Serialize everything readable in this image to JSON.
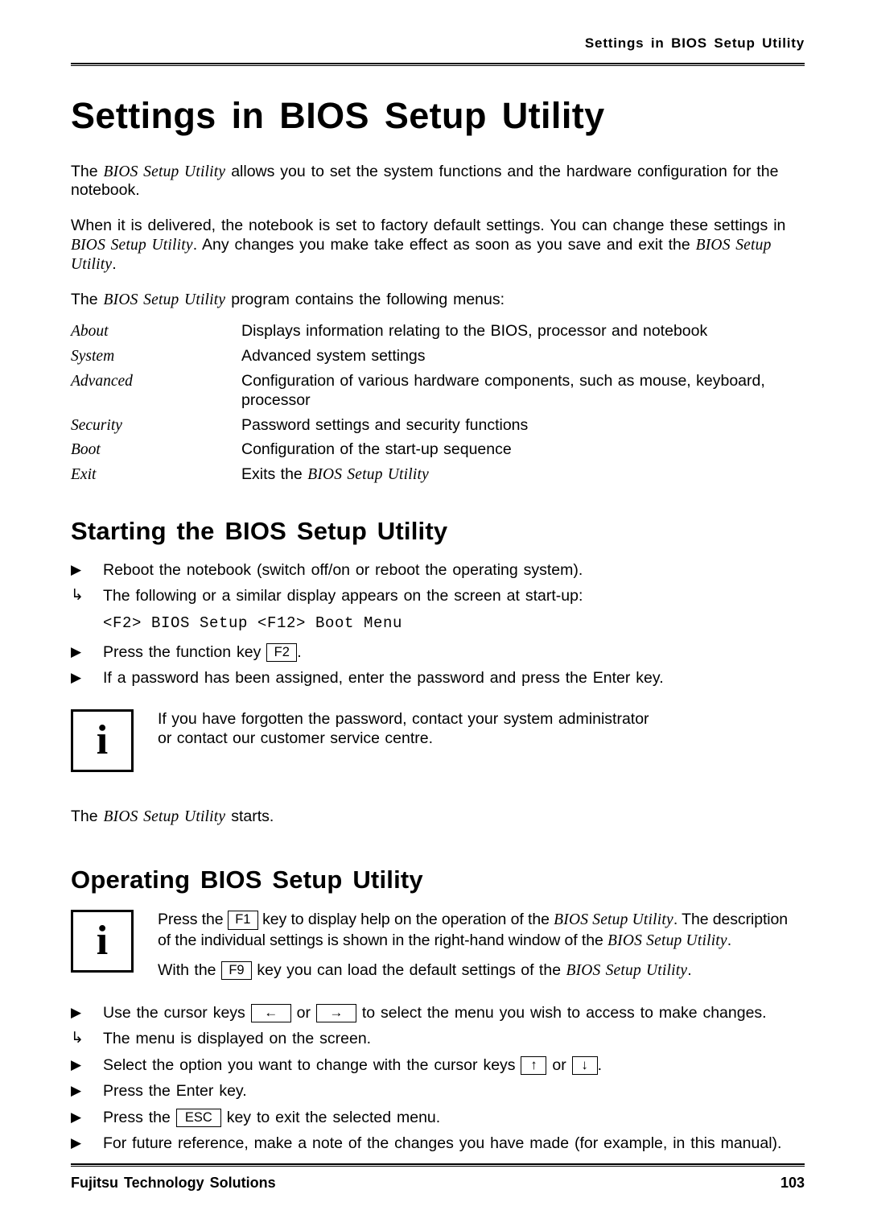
{
  "header": {
    "running_title": "Settings in BIOS Setup Utility"
  },
  "title": "Settings in BIOS Setup Utility",
  "intro": {
    "p1_a": "The ",
    "p1_term": "BIOS Setup Utility",
    "p1_b": " allows you to set the system functions and the hardware configuration for the notebook.",
    "p2_a": "When it is delivered, the notebook is set to factory default settings. You can change these settings in ",
    "p2_term1": "BIOS Setup Utility",
    "p2_b": ". Any changes you make take effect as soon as you save and exit the ",
    "p2_term2": "BIOS Setup Utility",
    "p2_c": ".",
    "p3_a": "The ",
    "p3_term": "BIOS Setup Utility",
    "p3_b": " program contains the following menus:"
  },
  "menus": [
    {
      "term": "About",
      "desc": "Displays information relating to the BIOS, processor and notebook"
    },
    {
      "term": "System",
      "desc": "Advanced system settings"
    },
    {
      "term": "Advanced",
      "desc": "Configuration of various hardware components, such as mouse, keyboard, processor"
    },
    {
      "term": "Security",
      "desc": "Password settings and security functions"
    },
    {
      "term": "Boot",
      "desc": "Configuration of the start-up sequence"
    },
    {
      "term": "Exit",
      "desc_a": "Exits the ",
      "desc_term": "BIOS Setup Utility",
      "desc_b": ""
    }
  ],
  "starting": {
    "heading": "Starting the BIOS Setup Utility",
    "step1_marker": "▶",
    "step1": "Reboot the notebook (switch off/on or reboot the operating system).",
    "step2_marker": "↳",
    "step2": "The following or a similar display appears on the screen at start-up:",
    "code": "<F2> BIOS Setup <F12> Boot Menu",
    "step3_marker": "▶",
    "step3_a": "Press the function key ",
    "step3_key": "F2",
    "step3_b": ".",
    "step4_marker": "▶",
    "step4": "If a password has been assigned, enter the password and press the Enter key.",
    "note_icon": "i",
    "note_line1": "If you have forgotten the password, contact your system administrator",
    "note_line2": "or contact our customer service centre.",
    "after_a": "The ",
    "after_term": "BIOS Setup Utility",
    "after_b": " starts."
  },
  "operating": {
    "heading": "Operating BIOS Setup Utility",
    "note_icon": "i",
    "note1_a": "Press the ",
    "note1_key": "F1",
    "note1_b": " key to display help on the operation of the ",
    "note1_term1": "BIOS Setup Utility",
    "note1_c": ". The description of the individual settings is shown in the right-hand window of the ",
    "note1_term2": "BIOS Setup Utility",
    "note1_d": ".",
    "note2_a": "With the ",
    "note2_key": "F9",
    "note2_b": " key you can load the default settings of the ",
    "note2_term": "BIOS Setup Utility",
    "note2_c": ".",
    "s1_marker": "▶",
    "s1_a": "Use the cursor keys ",
    "s1_key1": "←",
    "s1_b": " or ",
    "s1_key2": "→",
    "s1_c": " to select the menu you wish to access to make changes.",
    "s2_marker": "↳",
    "s2": "The menu is displayed on the screen.",
    "s3_marker": "▶",
    "s3_a": "Select the option you want to change with the cursor keys ",
    "s3_key1": "↑",
    "s3_b": " or ",
    "s3_key2": "↓",
    "s3_c": ".",
    "s4_marker": "▶",
    "s4": "Press the Enter key.",
    "s5_marker": "▶",
    "s5_a": "Press the ",
    "s5_key": "ESC",
    "s5_b": " key to exit the selected menu.",
    "s6_marker": "▶",
    "s6": "For future reference, make a note of the changes you have made (for example, in this manual)."
  },
  "footer": {
    "company": "Fujitsu Technology Solutions",
    "page_number": "103"
  }
}
